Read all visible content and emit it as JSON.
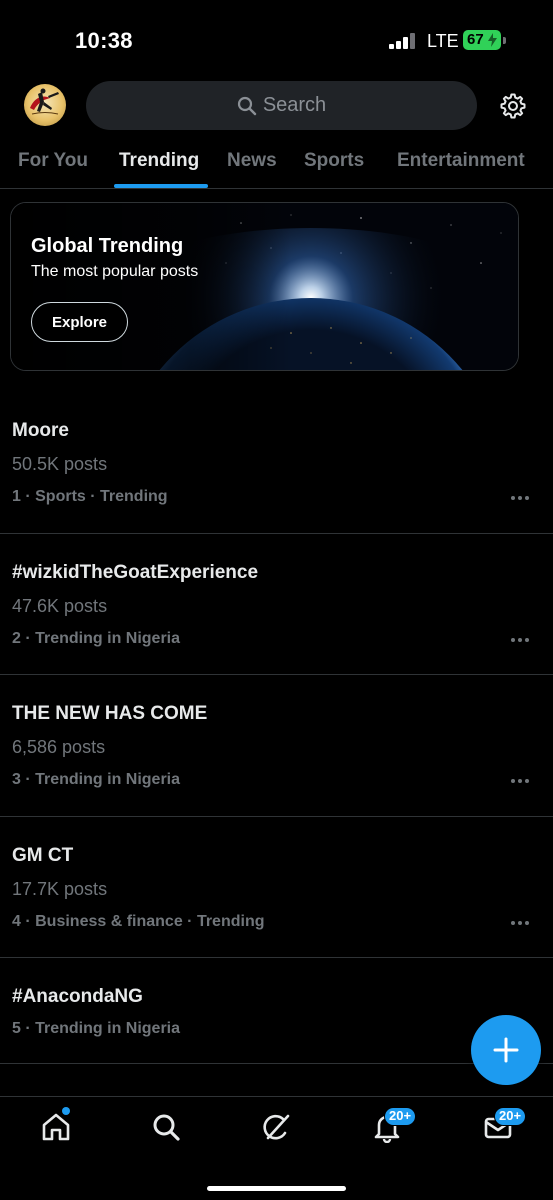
{
  "status_bar": {
    "time": "10:38",
    "network": "LTE",
    "battery": "67"
  },
  "header": {
    "search_placeholder": "Search"
  },
  "tabs": [
    {
      "label": "For You",
      "active": false
    },
    {
      "label": "Trending",
      "active": true
    },
    {
      "label": "News",
      "active": false
    },
    {
      "label": "Sports",
      "active": false
    },
    {
      "label": "Entertainment",
      "active": false
    }
  ],
  "banner": {
    "title": "Global Trending",
    "subtitle": "The most popular posts",
    "button_label": "Explore"
  },
  "trends": [
    {
      "name": "Moore",
      "count": "50.5K posts",
      "meta": "1 · Sports · Trending"
    },
    {
      "name": "#wizkidTheGoatExperience",
      "count": "47.6K posts",
      "meta": "2 · Trending in Nigeria"
    },
    {
      "name": "THE NEW HAS COME",
      "count": "6,586 posts",
      "meta": "3 · Trending in Nigeria"
    },
    {
      "name": "GM CT",
      "count": "17.7K posts",
      "meta": "4 · Business & finance · Trending"
    },
    {
      "name": "#AnacondaNG",
      "count": "",
      "meta": "5 · Trending in Nigeria"
    }
  ],
  "bottom_nav": {
    "notifications_badge": "20+",
    "messages_badge": "20+"
  },
  "colors": {
    "accent": "#1d9bf0",
    "background": "#000000",
    "muted_text": "#71767b",
    "battery": "#30d158"
  },
  "icons": {
    "home": "home-icon",
    "search": "search-icon",
    "grok": "grok-icon",
    "notifications": "bell-icon",
    "messages": "mail-icon",
    "settings": "gear-icon",
    "compose": "plus-icon"
  }
}
